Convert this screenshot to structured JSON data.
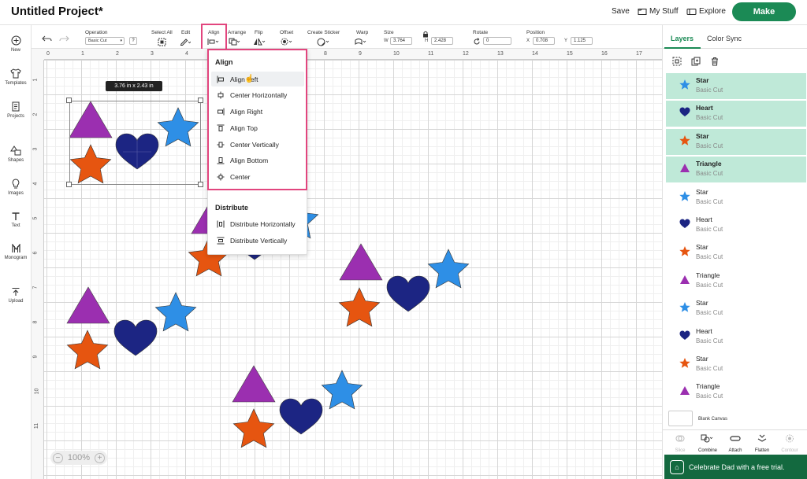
{
  "header": {
    "project_title": "Untitled Project*",
    "save": "Save",
    "my_stuff": "My Stuff",
    "explore": "Explore",
    "make": "Make"
  },
  "toolbar": {
    "operation_label": "Operation",
    "operation_value": "Basic Cut",
    "help": "?",
    "select_all": "Select All",
    "edit": "Edit",
    "align": "Align",
    "arrange": "Arrange",
    "flip": "Flip",
    "offset": "Offset",
    "create_sticker": "Create Sticker",
    "warp": "Warp",
    "size": "Size",
    "w_label": "W",
    "w_value": "3.764",
    "h_label": "H",
    "h_value": "2.428",
    "rotate": "Rotate",
    "rotate_value": "0",
    "position": "Position",
    "x_label": "X",
    "x_value": "0.708",
    "y_label": "Y",
    "y_value": "1.125"
  },
  "leftbar": [
    {
      "label": "New",
      "icon": "plus-circle-icon"
    },
    {
      "label": "Templates",
      "icon": "tshirt-icon"
    },
    {
      "label": "Projects",
      "icon": "document-icon"
    },
    {
      "label": "Shapes",
      "icon": "shapes-icon"
    },
    {
      "label": "Images",
      "icon": "lightbulb-icon"
    },
    {
      "label": "Text",
      "icon": "text-icon"
    },
    {
      "label": "Monogram",
      "icon": "monogram-icon"
    },
    {
      "label": "Upload",
      "icon": "upload-icon"
    }
  ],
  "rulers": {
    "top": [
      "0",
      "1",
      "2",
      "3",
      "4",
      "5",
      "6",
      "7",
      "8",
      "9",
      "10",
      "11",
      "12",
      "13",
      "14",
      "15",
      "16",
      "17"
    ],
    "left": [
      "1",
      "2",
      "3",
      "4",
      "5",
      "6",
      "7",
      "8",
      "9",
      "10",
      "11"
    ]
  },
  "canvas": {
    "size_tooltip": "3.76  in x 2.43  in",
    "zoom_minus": "−",
    "zoom_value": "100%",
    "zoom_plus": "+"
  },
  "align_menu": {
    "align_heading": "Align",
    "align_items": [
      {
        "label": "Align Left",
        "icon": "align-left-icon"
      },
      {
        "label": "Center Horizontally",
        "icon": "center-horizontal-icon"
      },
      {
        "label": "Align Right",
        "icon": "align-right-icon"
      },
      {
        "label": "Align Top",
        "icon": "align-top-icon"
      },
      {
        "label": "Center Vertically",
        "icon": "center-vertical-icon"
      },
      {
        "label": "Align Bottom",
        "icon": "align-bottom-icon"
      },
      {
        "label": "Center",
        "icon": "center-icon"
      }
    ],
    "distribute_heading": "Distribute",
    "distribute_items": [
      {
        "label": "Distribute Horizontally",
        "icon": "distribute-horizontal-icon"
      },
      {
        "label": "Distribute Vertically",
        "icon": "distribute-vertical-icon"
      }
    ]
  },
  "panel": {
    "tab_layers": "Layers",
    "tab_color_sync": "Color Sync",
    "layers": [
      {
        "name": "Star",
        "sub": "Basic Cut",
        "shape": "star",
        "color": "#2e8fe6",
        "selected": true
      },
      {
        "name": "Heart",
        "sub": "Basic Cut",
        "shape": "heart",
        "color": "#1c2583",
        "selected": true
      },
      {
        "name": "Star",
        "sub": "Basic Cut",
        "shape": "star",
        "color": "#e65510",
        "selected": true
      },
      {
        "name": "Triangle",
        "sub": "Basic Cut",
        "shape": "triangle",
        "color": "#9b2fb0",
        "selected": true
      },
      {
        "name": "Star",
        "sub": "Basic Cut",
        "shape": "star",
        "color": "#2e8fe6",
        "selected": false
      },
      {
        "name": "Heart",
        "sub": "Basic Cut",
        "shape": "heart",
        "color": "#1c2583",
        "selected": false
      },
      {
        "name": "Star",
        "sub": "Basic Cut",
        "shape": "star",
        "color": "#e65510",
        "selected": false
      },
      {
        "name": "Triangle",
        "sub": "Basic Cut",
        "shape": "triangle",
        "color": "#9b2fb0",
        "selected": false
      },
      {
        "name": "Star",
        "sub": "Basic Cut",
        "shape": "star",
        "color": "#2e8fe6",
        "selected": false
      },
      {
        "name": "Heart",
        "sub": "Basic Cut",
        "shape": "heart",
        "color": "#1c2583",
        "selected": false
      },
      {
        "name": "Star",
        "sub": "Basic Cut",
        "shape": "star",
        "color": "#e65510",
        "selected": false
      },
      {
        "name": "Triangle",
        "sub": "Basic Cut",
        "shape": "triangle",
        "color": "#9b2fb0",
        "selected": false
      }
    ],
    "blank_canvas": "Blank Canvas",
    "bottom_tools": [
      "Slice",
      "Combine",
      "Attach",
      "Flatten",
      "Contour"
    ]
  },
  "promo": "Celebrate Dad with a free trial.",
  "colors": {
    "accent": "#1b8a55",
    "highlight": "#e2457e",
    "star_blue": "#2e8fe6",
    "heart_navy": "#1c2583",
    "star_orange": "#e65510",
    "triangle_purple": "#9b2fb0"
  }
}
